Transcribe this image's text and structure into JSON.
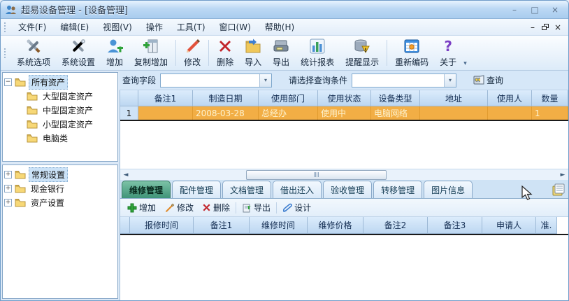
{
  "window": {
    "title": "超易设备管理 - [设备管理]",
    "controls": {
      "minimize": "–",
      "maximize": "□",
      "close": "×"
    },
    "mdi_controls": {
      "minimize": "–",
      "close": "×"
    }
  },
  "menu": {
    "items": [
      "文件(F)",
      "编辑(E)",
      "视图(V)",
      "操作",
      "工具(T)",
      "窗口(W)",
      "帮助(H)"
    ]
  },
  "toolbar": {
    "buttons": [
      {
        "label": "系统选项",
        "icon": "tools-icon"
      },
      {
        "label": "系统设置",
        "icon": "settings-icon"
      },
      {
        "label": "增加",
        "icon": "user-add-icon"
      },
      {
        "label": "复制增加",
        "icon": "copy-add-icon"
      },
      {
        "label": "修改",
        "icon": "pencil-icon"
      },
      {
        "label": "删除",
        "icon": "delete-icon"
      },
      {
        "label": "导入",
        "icon": "import-icon"
      },
      {
        "label": "导出",
        "icon": "export-icon"
      },
      {
        "label": "统计报表",
        "icon": "chart-icon"
      },
      {
        "label": "提醒显示",
        "icon": "alert-icon"
      },
      {
        "label": "重新编码",
        "icon": "recode-icon"
      },
      {
        "label": "关于",
        "icon": "question-icon",
        "glyph": "?"
      }
    ]
  },
  "query_bar": {
    "field_label": "查询字段",
    "field_value": "",
    "condition_label": "请选择查询条件",
    "condition_value": "",
    "search_label": "查询"
  },
  "asset_tree": {
    "root": "所有资产",
    "children": [
      "大型固定资产",
      "中型固定资产",
      "小型固定资产",
      "电脑类"
    ]
  },
  "settings_tree": {
    "items": [
      "常规设置",
      "现金银行",
      "资产设置"
    ]
  },
  "main_table": {
    "columns": [
      "备注1",
      "制造日期",
      "使用部门",
      "使用状态",
      "设备类型",
      "地址",
      "使用人",
      "数量"
    ],
    "rows": [
      {
        "num": "1",
        "cells": [
          "",
          "2008-03-28",
          "总经办",
          "使用中",
          "电脑网络",
          "",
          "",
          "1"
        ]
      }
    ]
  },
  "detail": {
    "active_tab": "维修管理",
    "tabs": [
      "维修管理",
      "配件管理",
      "文档管理",
      "借出还入",
      "验收管理",
      "转移管理",
      "图片信息"
    ],
    "toolbar": [
      {
        "label": "增加",
        "icon": "add-icon"
      },
      {
        "label": "修改",
        "icon": "edit-icon"
      },
      {
        "label": "删除",
        "icon": "delete-icon"
      },
      {
        "label": "导出",
        "icon": "export-doc-icon"
      },
      {
        "label": "设计",
        "icon": "design-icon"
      }
    ],
    "columns": [
      "报修时间",
      "备注1",
      "维修时间",
      "维修价格",
      "备注2",
      "备注3",
      "申请人",
      "准."
    ]
  },
  "colors": {
    "titlebar": "#bcd8f4",
    "selected_row": "#f2ae45",
    "table_header": "#c7ddf4",
    "active_tab": "#4fa184",
    "window_frame": "#6f9cc9"
  }
}
